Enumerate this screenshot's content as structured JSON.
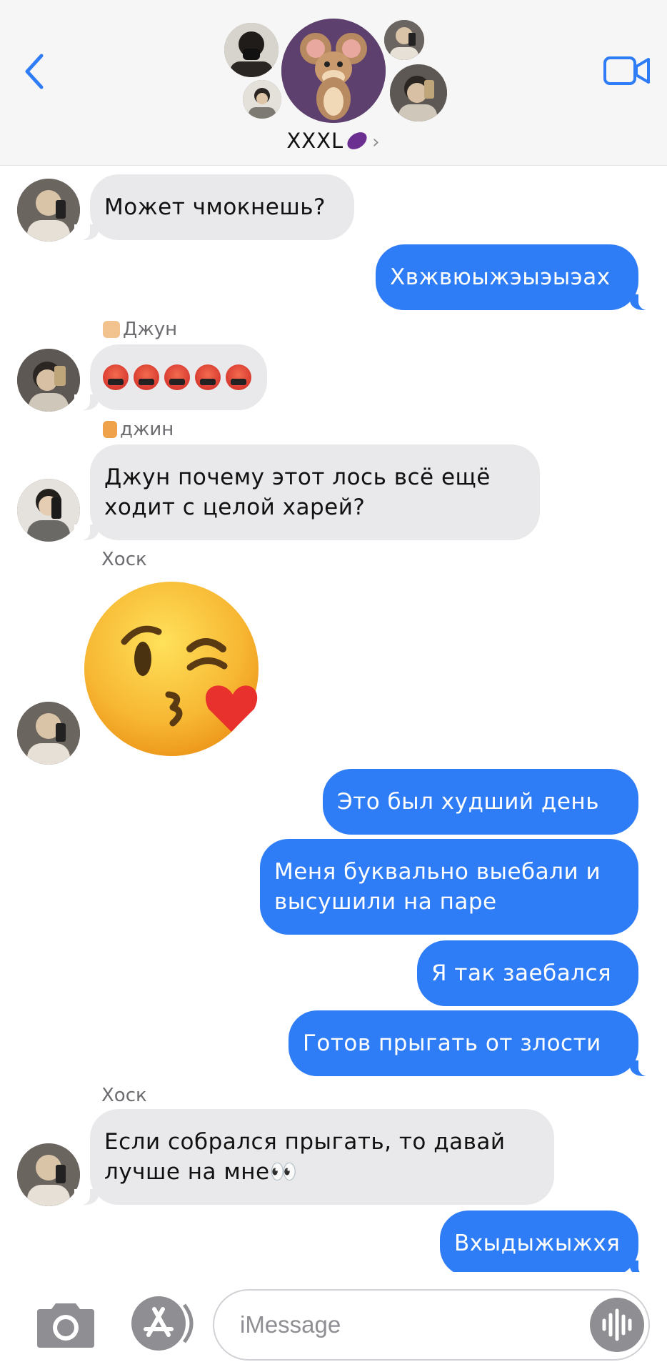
{
  "header": {
    "group_name": "XXXL",
    "chevron": "›",
    "back_icon": "chevron-left-icon",
    "video_icon": "video-camera-icon",
    "accent_color": "#2f7df6"
  },
  "messages": [
    {
      "id": "m1",
      "dir": "in",
      "text": "Может чмокнешь?"
    },
    {
      "id": "m2",
      "dir": "out",
      "text": "Хвжвюыжэыэыэах"
    },
    {
      "id": "m3",
      "dir": "in",
      "sender": "Джун",
      "text": "😡😡😡😡😡",
      "emoji_name": "angry-face-with-symbols-icon"
    },
    {
      "id": "m4",
      "dir": "in",
      "sender": "джин",
      "text": "Джун почему этот лось  всё ещё ходит с целой харей?"
    },
    {
      "id": "m5",
      "dir": "in",
      "sender": "Хоск",
      "sticker": "face-blowing-kiss-icon"
    },
    {
      "id": "m6",
      "dir": "out",
      "text": "Это был худший день"
    },
    {
      "id": "m7",
      "dir": "out",
      "text": "Меня буквально выебали и высушили на паре"
    },
    {
      "id": "m8",
      "dir": "out",
      "text": "Я так заебался"
    },
    {
      "id": "m9",
      "dir": "out",
      "text": "Готов прыгать от злости"
    },
    {
      "id": "m10",
      "dir": "in",
      "sender": "Хоск",
      "text": "Если собрался прыгать,  то давай лучше на мне👀"
    },
    {
      "id": "m11",
      "dir": "out",
      "text": "Вхыдыжыжхя"
    }
  ],
  "input": {
    "placeholder": "iMessage",
    "camera_icon": "camera-icon",
    "apps_icon": "app-store-icon",
    "audio_icon": "audio-waveform-icon"
  }
}
